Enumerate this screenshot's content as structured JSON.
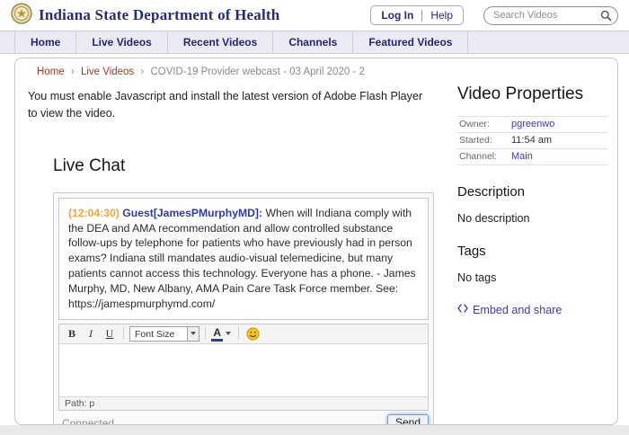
{
  "colors": {
    "accent_navy": "#262a7c",
    "nav_background": "#ebebf3",
    "breadcrumb_link": "#993a21",
    "timestamp_orange": "#f2a33c",
    "author_blue": "#2b3ba6",
    "link_blue": "#3b3bb0",
    "send_focus_blue": "#6f9fd8"
  },
  "header": {
    "site_title": "Indiana State Department of Health",
    "login_label": "Log In",
    "help_label": "Help",
    "search_placeholder": "Search Videos"
  },
  "nav": {
    "items": [
      {
        "label": "Home"
      },
      {
        "label": "Live Videos"
      },
      {
        "label": "Recent Videos"
      },
      {
        "label": "Channels"
      },
      {
        "label": "Featured Videos"
      }
    ]
  },
  "breadcrumb": {
    "separator": "›",
    "items": [
      {
        "label": "Home"
      },
      {
        "label": "Live Videos"
      },
      {
        "label": "COVID-19 Provider webcast - 03 April 2020 - 2"
      }
    ]
  },
  "main": {
    "flash_notice": "You must enable Javascript and install the latest version of Adobe Flash Player to view the video.",
    "live_chat_title": "Live Chat",
    "chat": {
      "message": {
        "timestamp": "(12:04:30)",
        "author": "Guest[JamesPMurphyMD]:",
        "text": "When will Indiana comply with the DEA and AMA recommendation and allow controlled substance follow-ups by telephone for patients who have previously had in person exams? Indiana still mandates audio-visual telemedicine, but many patients cannot access this technology. Everyone has a phone. - James Murphy, MD, New Albany, AMA Pain Care Task Force member. See: https://jamespmurphymd.com/"
      },
      "editor": {
        "bold_label": "B",
        "italic_label": "I",
        "underline_label": "U",
        "font_size_label": "Font Size",
        "text_color_label": "A",
        "path_label": "Path: p"
      },
      "status": "Connected",
      "send_label": "Send"
    }
  },
  "sidebar": {
    "title": "Video Properties",
    "properties": [
      {
        "label": "Owner:",
        "value": "pgreenwo"
      },
      {
        "label": "Started:",
        "value": "11:54 am"
      },
      {
        "label": "Channel:",
        "value": "Main"
      }
    ],
    "description_title": "Description",
    "description_value": "No description",
    "tags_title": "Tags",
    "tags_value": "No tags",
    "embed_label": "Embed and share"
  }
}
